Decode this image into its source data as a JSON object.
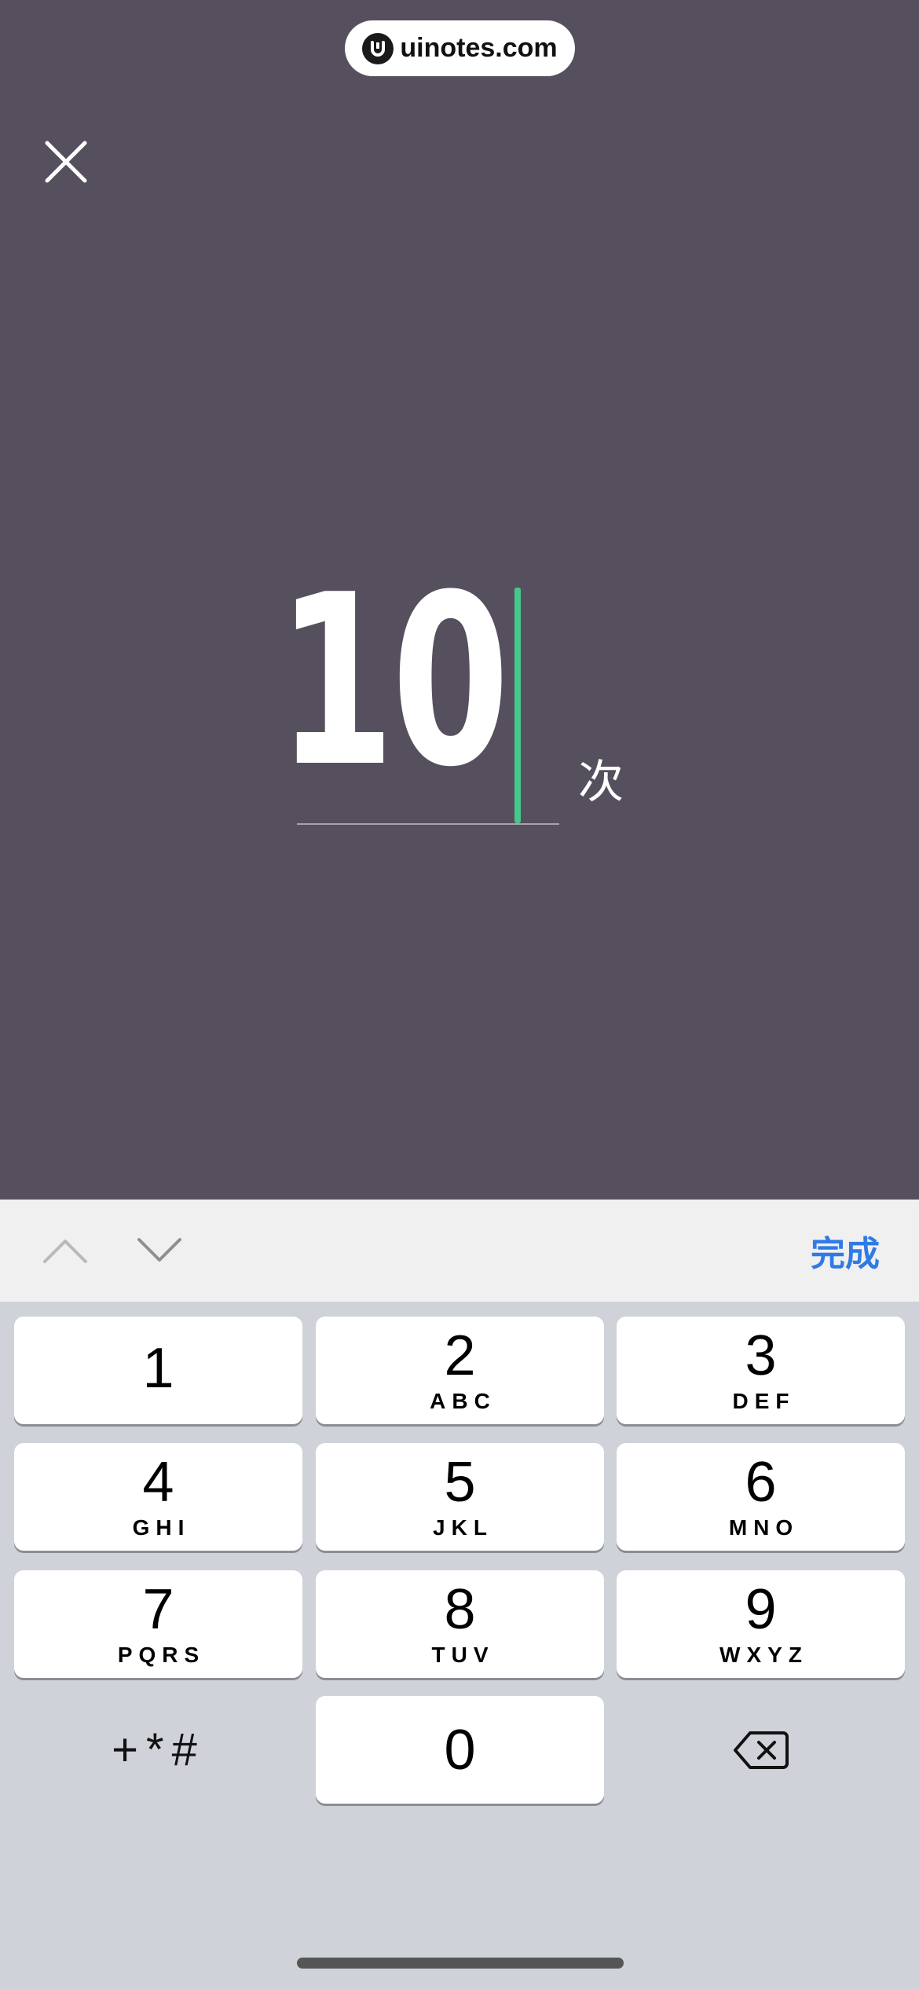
{
  "watermark": {
    "text": "uinotes.com"
  },
  "header": {
    "close_icon": "close-icon"
  },
  "input": {
    "value": "10",
    "unit": "次"
  },
  "accessory_bar": {
    "prev_icon": "chevron-up-icon",
    "next_icon": "chevron-down-icon",
    "done_label": "完成"
  },
  "keypad": {
    "keys": [
      {
        "num": "1",
        "letters": ""
      },
      {
        "num": "2",
        "letters": "ABC"
      },
      {
        "num": "3",
        "letters": "DEF"
      },
      {
        "num": "4",
        "letters": "GHI"
      },
      {
        "num": "5",
        "letters": "JKL"
      },
      {
        "num": "6",
        "letters": "MNO"
      },
      {
        "num": "7",
        "letters": "PQRS"
      },
      {
        "num": "8",
        "letters": "TUV"
      },
      {
        "num": "9",
        "letters": "WXYZ"
      },
      {
        "num": "0",
        "letters": ""
      }
    ],
    "symbols_label": "+*#",
    "delete_icon": "backspace-icon"
  },
  "colors": {
    "background": "#56505e",
    "caret": "#45c98a",
    "accent": "#2f7be6",
    "keyboard": "#cfd2d8"
  }
}
